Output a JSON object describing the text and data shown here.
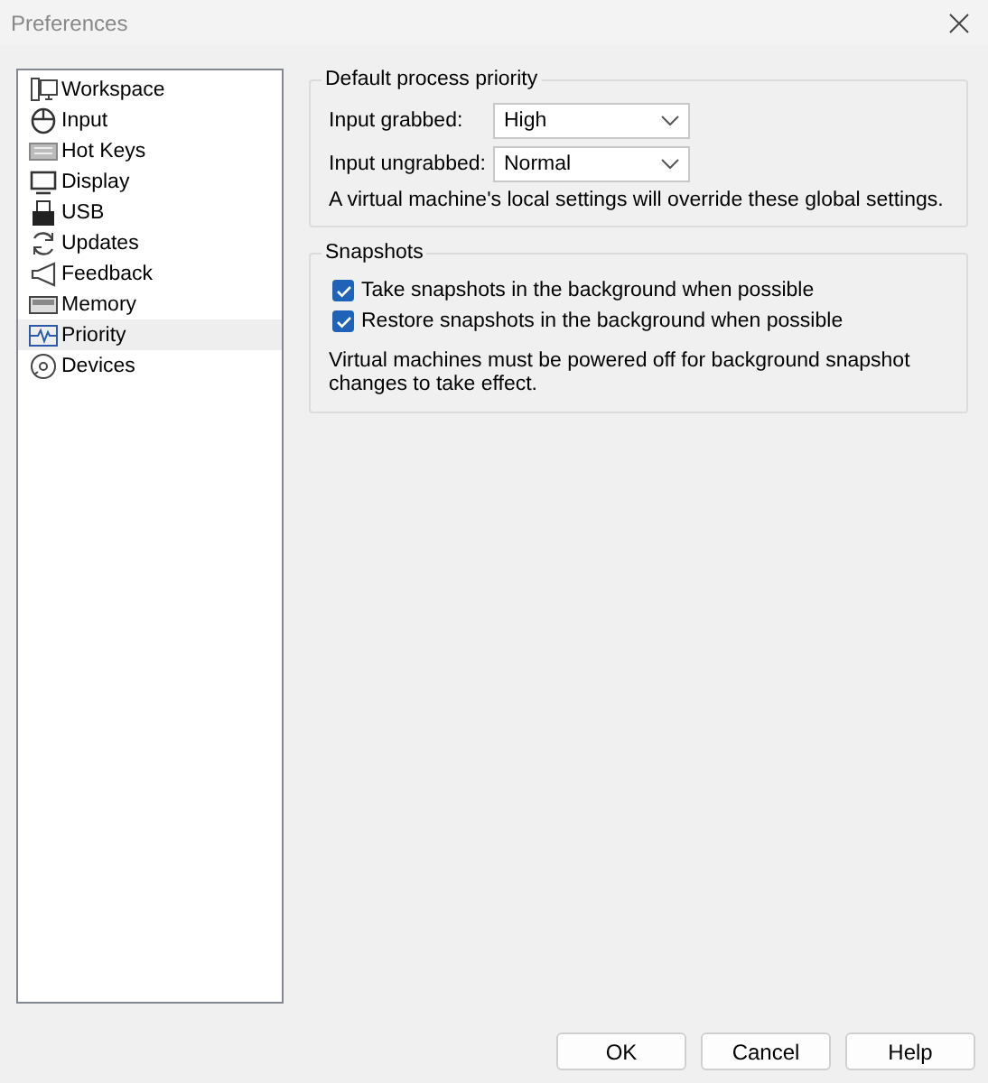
{
  "window": {
    "title": "Preferences"
  },
  "sidebar": {
    "items": [
      {
        "label": "Workspace",
        "selected": false
      },
      {
        "label": "Input",
        "selected": false
      },
      {
        "label": "Hot Keys",
        "selected": false
      },
      {
        "label": "Display",
        "selected": false
      },
      {
        "label": "USB",
        "selected": false
      },
      {
        "label": "Updates",
        "selected": false
      },
      {
        "label": "Feedback",
        "selected": false
      },
      {
        "label": "Memory",
        "selected": false
      },
      {
        "label": "Priority",
        "selected": true
      },
      {
        "label": "Devices",
        "selected": false
      }
    ]
  },
  "priority_group": {
    "title": "Default process priority",
    "fields": [
      {
        "label": "Input grabbed:",
        "value": "High"
      },
      {
        "label": "Input ungrabbed:",
        "value": "Normal"
      }
    ],
    "note": "A virtual machine's local settings will override these global settings."
  },
  "snapshots_group": {
    "title": "Snapshots",
    "options": [
      {
        "label": "Take snapshots in the background when possible",
        "checked": true
      },
      {
        "label": "Restore snapshots in the background when possible",
        "checked": true
      }
    ],
    "note": "Virtual machines must be powered off for background snapshot changes to take effect."
  },
  "buttons": [
    "OK",
    "Cancel",
    "Help"
  ]
}
